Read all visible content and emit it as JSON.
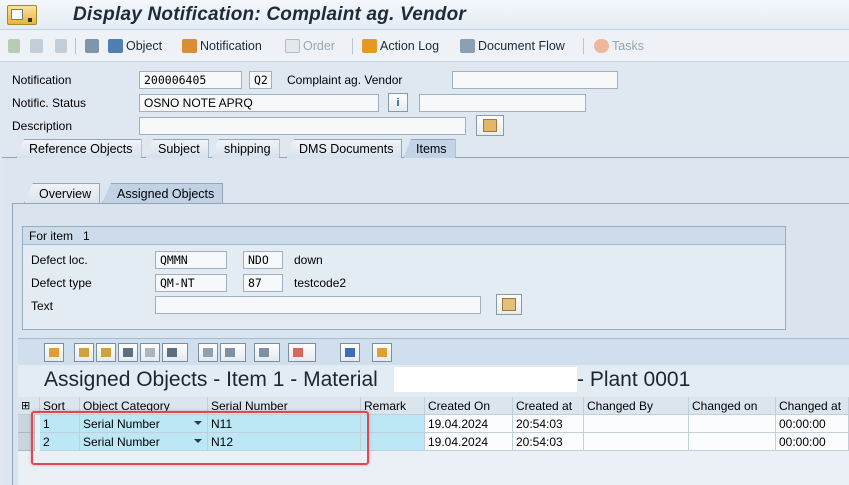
{
  "window": {
    "title": "Display Notification: Complaint ag. Vendor"
  },
  "toolbar": {
    "object_label": "Object",
    "notification_label": "Notification",
    "order_label": "Order",
    "action_log_label": "Action Log",
    "document_flow_label": "Document Flow",
    "tasks_label": "Tasks"
  },
  "header": {
    "notification_label": "Notification",
    "notification_value": "200006405",
    "notification_type": "Q2",
    "notification_type_text": "Complaint ag. Vendor",
    "status_label": "Notific. Status",
    "status_value": "OSNO NOTE APRQ",
    "status_info_button": "i",
    "description_label": "Description",
    "description_value": ""
  },
  "tabs": [
    "Reference Objects",
    "Subject",
    "shipping",
    "DMS Documents",
    "Items"
  ],
  "active_tab": "Items",
  "subtabs": [
    "Overview",
    "Assigned Objects"
  ],
  "active_subtab": "Assigned Objects",
  "item": {
    "title_label": "For item",
    "title_value": "1",
    "defect_loc_label": "Defect loc.",
    "defect_loc_catalog": "QMMN",
    "defect_loc_code": "NDO",
    "defect_loc_text": "down",
    "defect_type_label": "Defect type",
    "defect_type_catalog": "QM-NT",
    "defect_type_code": "87",
    "defect_type_text": "testcode2",
    "text_label": "Text",
    "text_value": ""
  },
  "alv": {
    "title_prefix": "Assigned Objects - Item 1 - Material",
    "title_suffix": "- Plant 0001",
    "columns": [
      "Sort",
      "Object Category",
      "Serial Number",
      "Remark",
      "Created On",
      "Created at",
      "Changed By",
      "Changed on",
      "Changed at"
    ],
    "rows": [
      {
        "sort": "1",
        "category": "Serial Number",
        "serial": "N11",
        "remark": "",
        "created_on": "19.04.2024",
        "created_at": "20:54:03",
        "changed_by": "",
        "changed_on": "",
        "changed_at": "00:00:00"
      },
      {
        "sort": "2",
        "category": "Serial Number",
        "serial": "N12",
        "remark": "",
        "created_on": "19.04.2024",
        "created_at": "20:54:03",
        "changed_by": "",
        "changed_on": "",
        "changed_at": "00:00:00"
      }
    ]
  },
  "colors": {
    "accent": "#e0474f",
    "selected_row": "#bce7f5"
  }
}
